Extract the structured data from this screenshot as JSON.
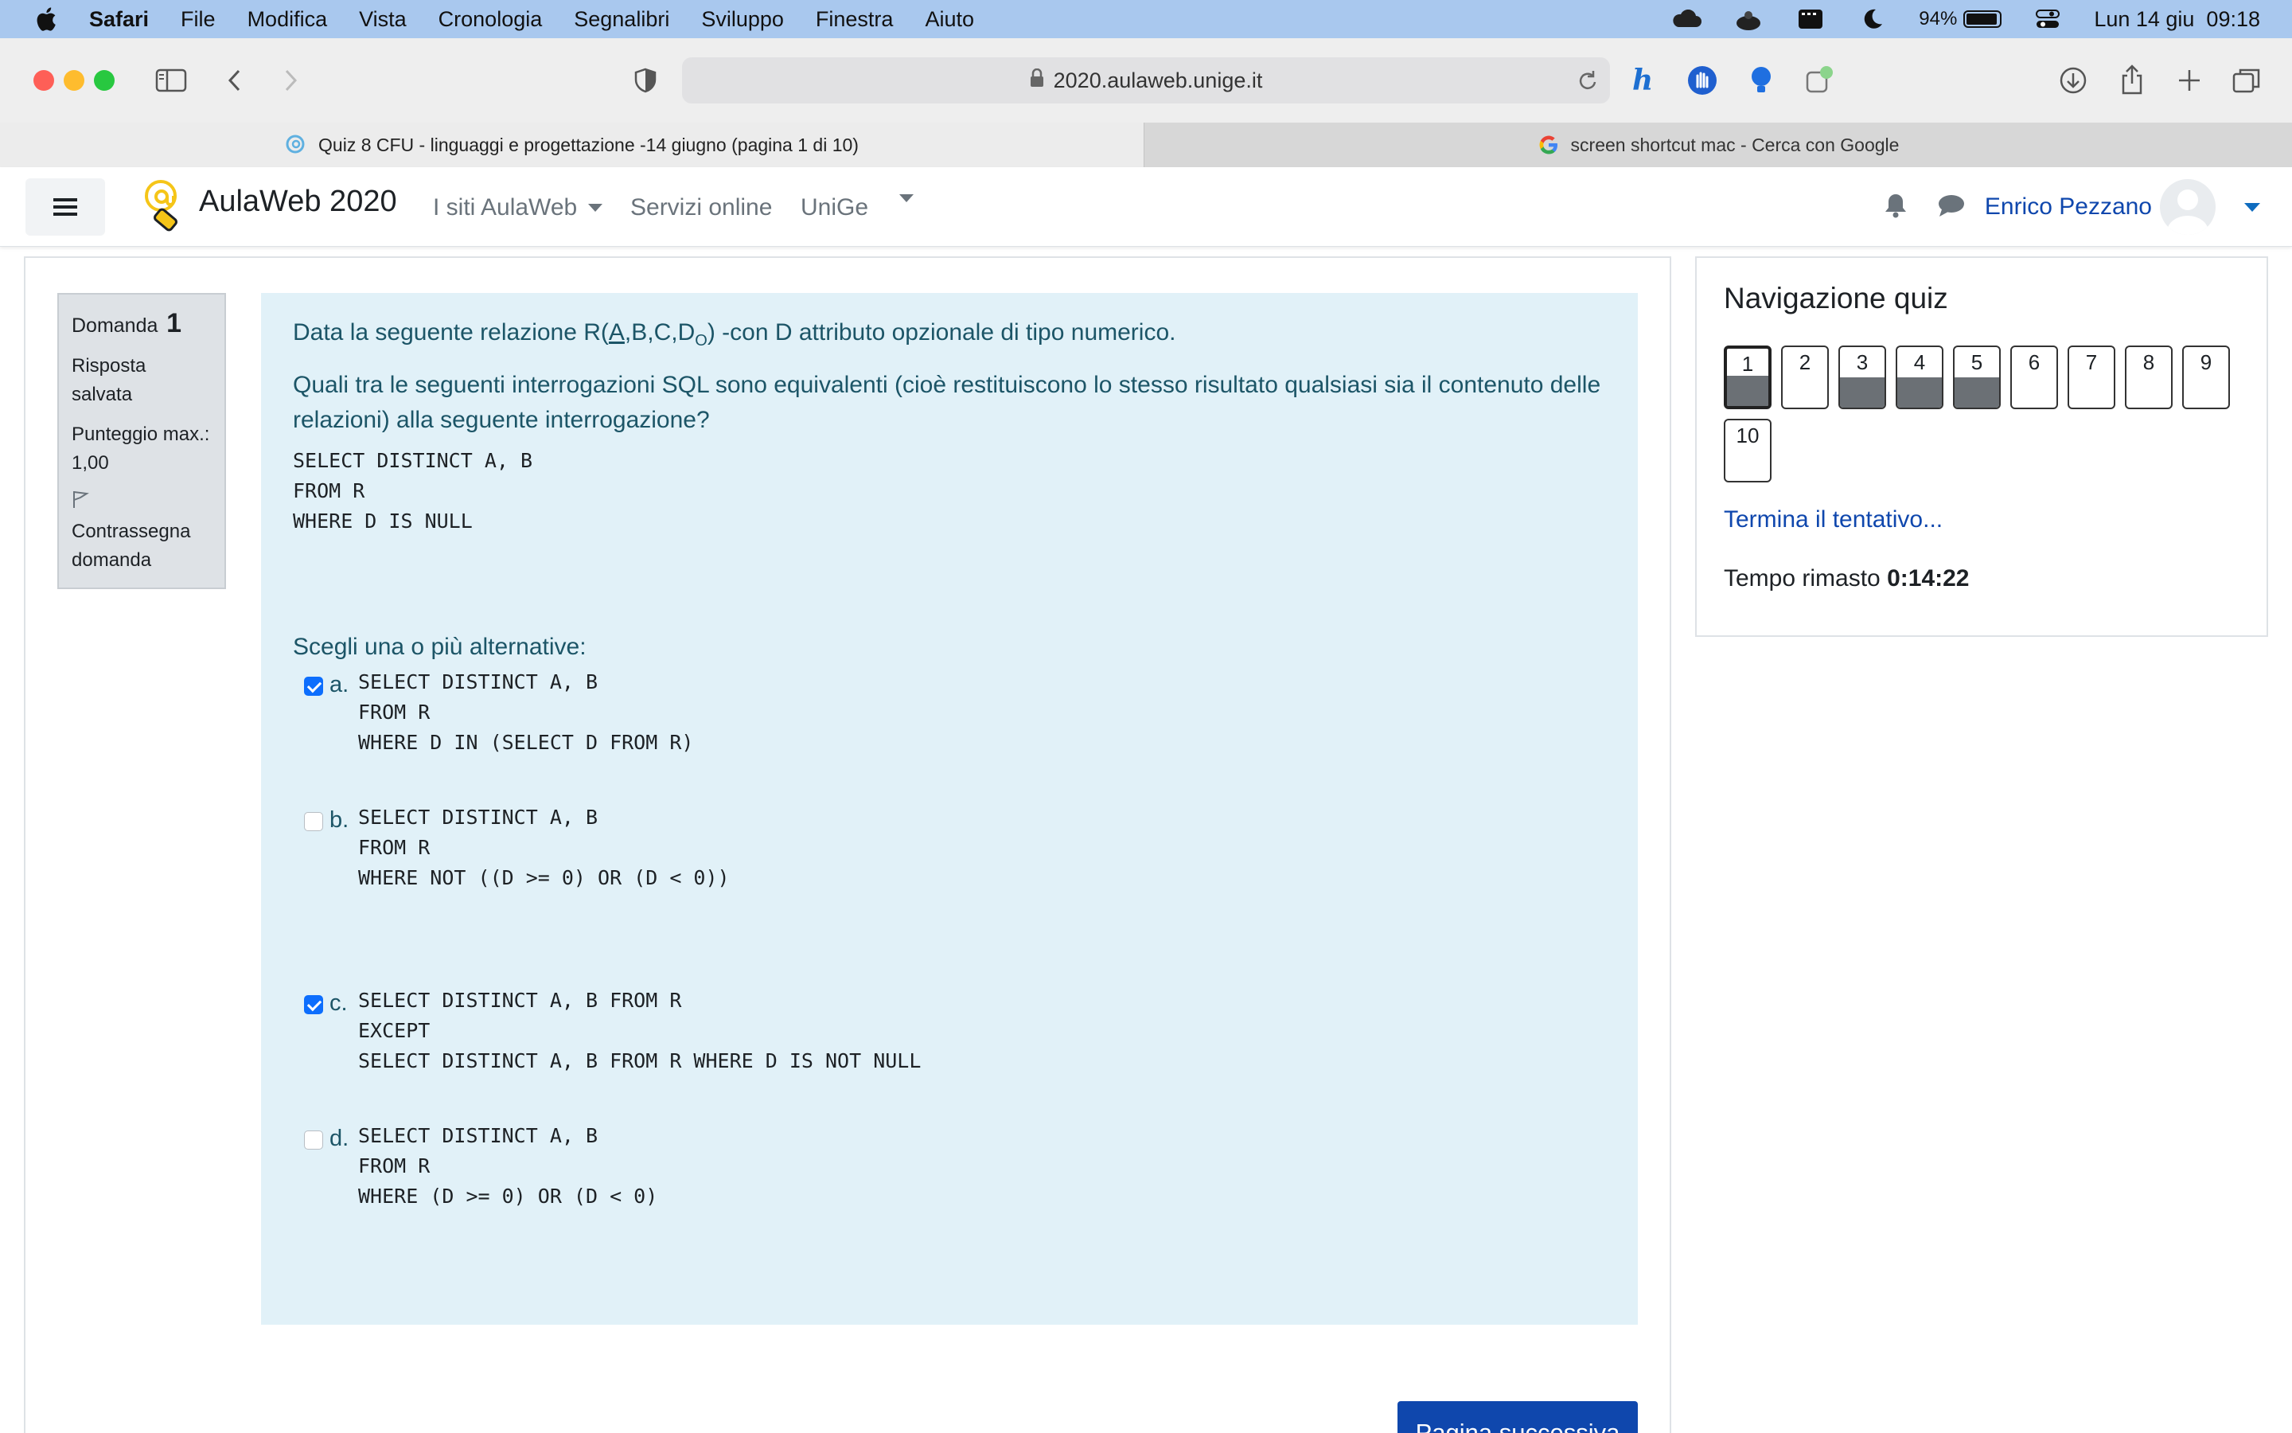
{
  "menubar": {
    "app_name": "Safari",
    "items": [
      "File",
      "Modifica",
      "Vista",
      "Cronologia",
      "Segnalibri",
      "Sviluppo",
      "Finestra",
      "Aiuto"
    ],
    "battery": "94%",
    "datetime": "Lun 14 giu  09:18"
  },
  "browser": {
    "url": "2020.aulaweb.unige.it",
    "tabs": [
      {
        "title": "Quiz 8 CFU - linguaggi e progettazione -14 giugno (pagina 1 di 10)",
        "active": true
      },
      {
        "title": "screen shortcut mac - Cerca con Google",
        "active": false
      }
    ]
  },
  "navbar": {
    "brand": "AulaWeb 2020",
    "links": [
      "I siti AulaWeb",
      "Servizi online",
      "UniGe"
    ],
    "user": "Enrico Pezzano"
  },
  "question": {
    "label": "Domanda",
    "number": "1",
    "status": "Risposta salvata",
    "score": "Punteggio max.: 1,00",
    "flag": "Contrassegna domanda",
    "text_before": "Data la seguente relazione R(",
    "key_attr": "A",
    "text_attrs": ",B,C,D",
    "sub": "O",
    "text_after": ") -con D attributo opzionale di tipo numerico.",
    "text2": "Quali tra le seguenti interrogazioni SQL sono equivalenti (cioè restituiscono lo stesso risultato qualsiasi sia il contenuto delle relazioni) alla seguente interrogazione?",
    "sql": "SELECT DISTINCT A, B\nFROM R\nWHERE D IS NULL",
    "prompt": "Scegli una o più alternative:",
    "answers": [
      {
        "letter": "a.",
        "checked": true,
        "sql": "SELECT DISTINCT A, B\nFROM R\nWHERE D IN (SELECT D FROM R)"
      },
      {
        "letter": "b.",
        "checked": false,
        "sql": "SELECT DISTINCT A, B\nFROM R\nWHERE NOT ((D >= 0) OR (D < 0))"
      },
      {
        "letter": "c.",
        "checked": true,
        "sql": "SELECT DISTINCT A, B FROM R\nEXCEPT\nSELECT DISTINCT A, B FROM R WHERE D IS NOT NULL"
      },
      {
        "letter": "d.",
        "checked": false,
        "sql": "SELECT DISTINCT A, B\nFROM R\nWHERE (D >= 0) OR (D < 0)"
      }
    ],
    "next_button": "Pagina successiva"
  },
  "quiz_nav": {
    "title": "Navigazione quiz",
    "buttons": [
      {
        "label": "1",
        "answered": true,
        "current": true
      },
      {
        "label": "2",
        "answered": false,
        "current": false
      },
      {
        "label": "3",
        "answered": true,
        "current": false
      },
      {
        "label": "4",
        "answered": true,
        "current": false
      },
      {
        "label": "5",
        "answered": true,
        "current": false
      },
      {
        "label": "6",
        "answered": false,
        "current": false
      },
      {
        "label": "7",
        "answered": false,
        "current": false
      },
      {
        "label": "8",
        "answered": false,
        "current": false
      },
      {
        "label": "9",
        "answered": false,
        "current": false
      },
      {
        "label": "10",
        "answered": false,
        "current": false
      }
    ],
    "finish": "Termina il tentativo...",
    "time_label": "Tempo rimasto",
    "time_value": "0:14:22"
  }
}
